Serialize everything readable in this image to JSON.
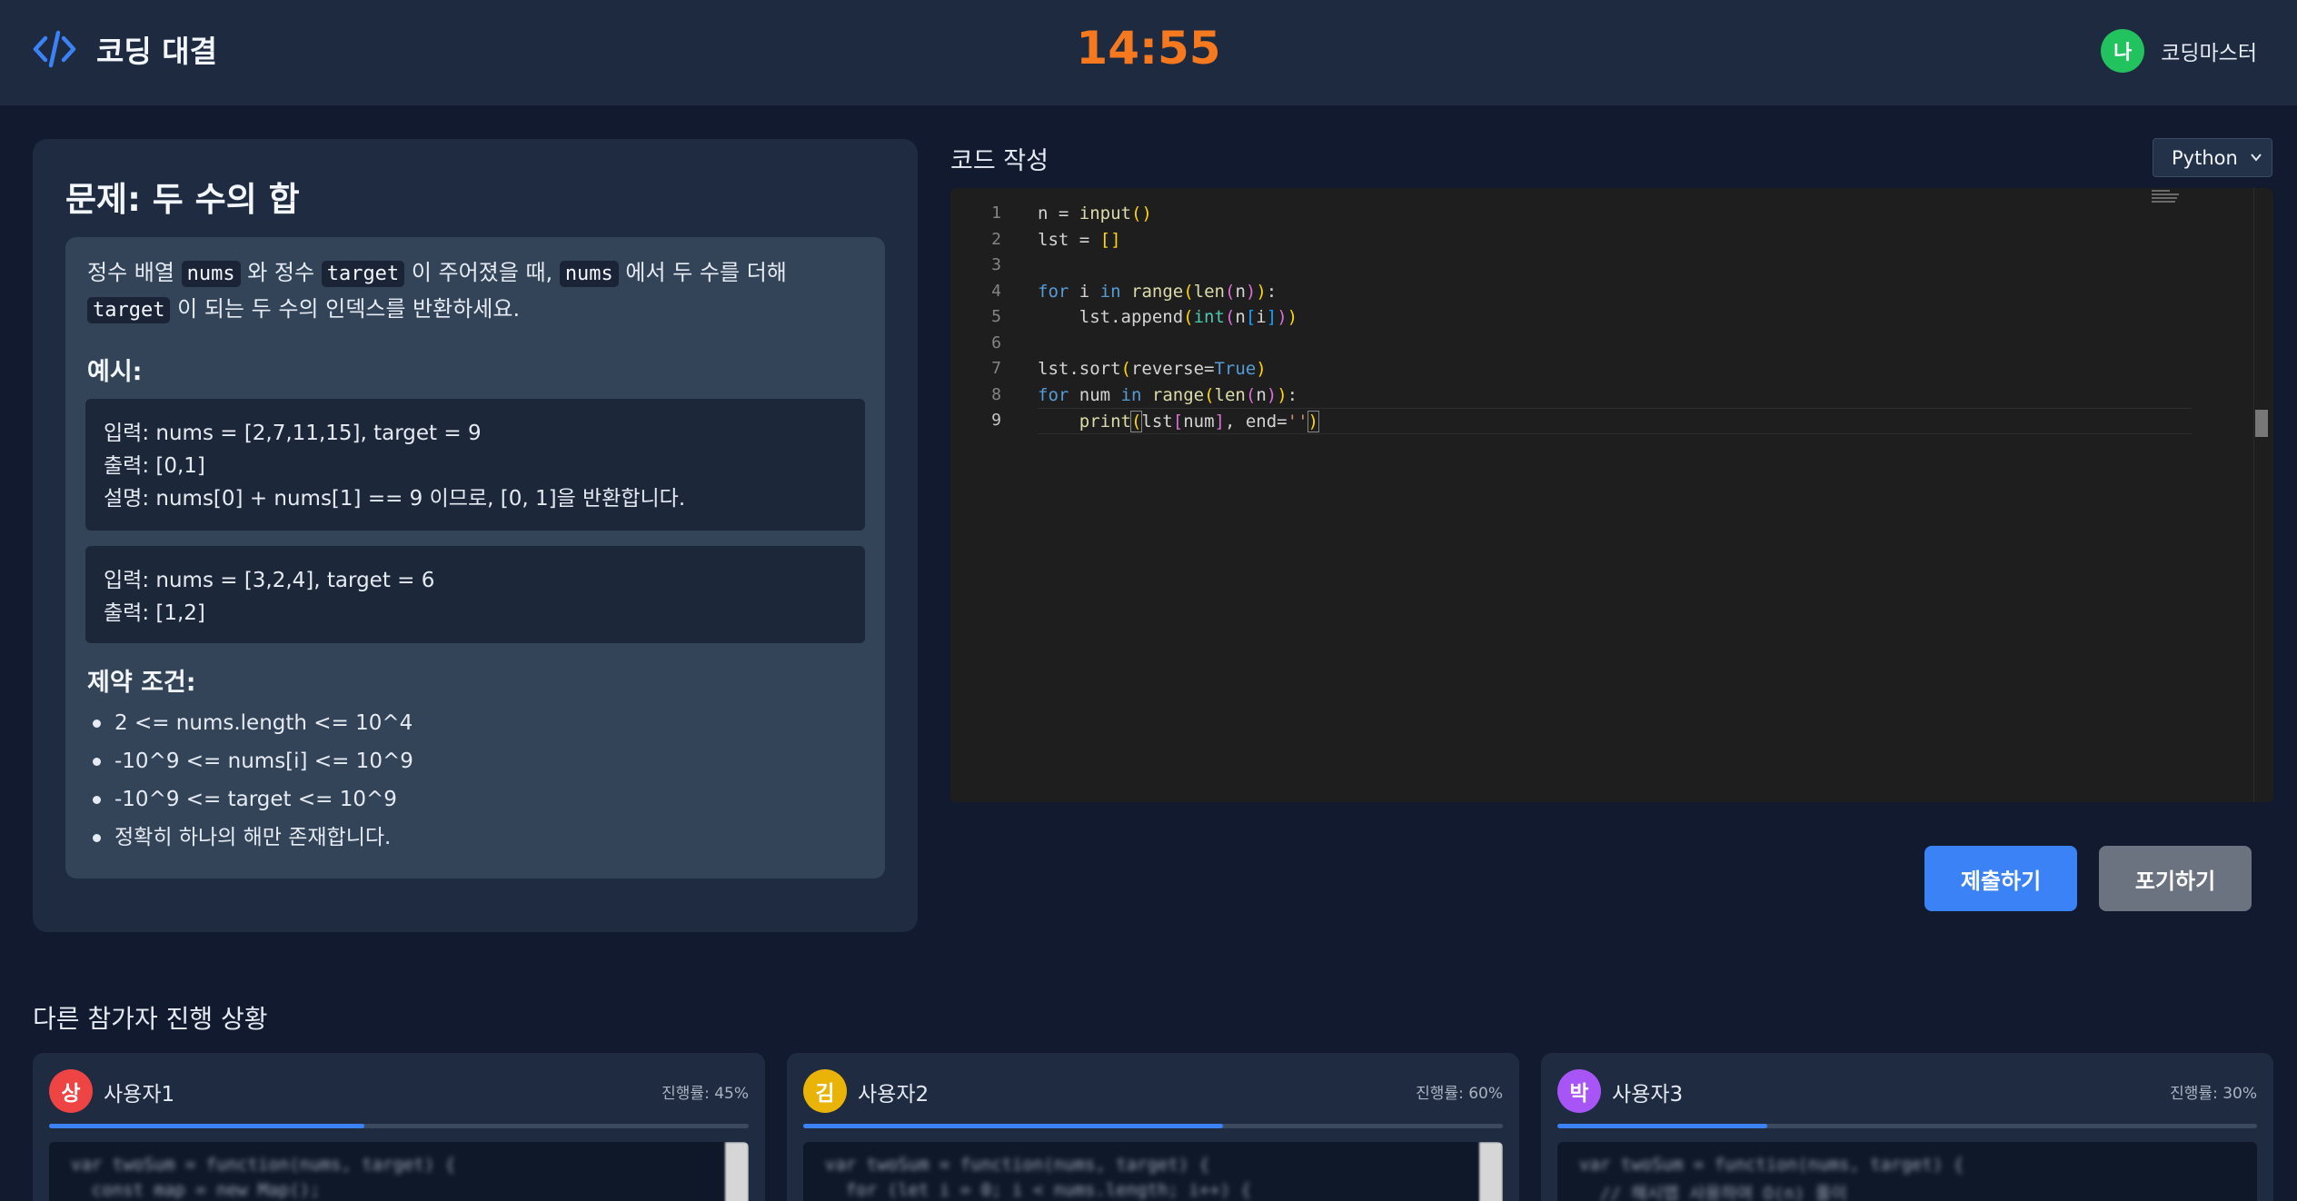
{
  "header": {
    "brand_title": "코딩 대결",
    "timer": "14:55",
    "user_initial": "나",
    "user_name": "코딩마스터"
  },
  "problem": {
    "title": "문제: 두 수의 합",
    "desc_1": "정수 배열 ",
    "desc_code_1": "nums",
    "desc_2": " 와 정수 ",
    "desc_code_2": "target",
    "desc_3": " 이 주어졌을 때, ",
    "desc_code_3": "nums",
    "desc_4": " 에서 두 수를 더해 ",
    "desc_code_4": "target",
    "desc_5": " 이 되는 두 수의 인덱스를 반환하세요.",
    "examples_heading": "예시:",
    "examples": [
      {
        "lines": [
          "입력: nums = [2,7,11,15], target = 9",
          "출력: [0,1]",
          "설명: nums[0] + nums[1] == 9 이므로, [0, 1]을 반환합니다."
        ]
      },
      {
        "lines": [
          "입력: nums = [3,2,4], target = 6",
          "출력: [1,2]"
        ]
      }
    ],
    "constraints_heading": "제약 조건:",
    "constraints": [
      "2 <= nums.length <= 10^4",
      "-10^9 <= nums[i] <= 10^9",
      "-10^9 <= target <= 10^9",
      "정확히 하나의 해만 존재합니다."
    ]
  },
  "editor": {
    "label": "코드 작성",
    "language": "Python",
    "line_numbers": [
      "1",
      "2",
      "3",
      "4",
      "5",
      "6",
      "7",
      "8",
      "9"
    ],
    "active_line": 9
  },
  "buttons": {
    "submit": "제출하기",
    "give_up": "포기하기"
  },
  "others": {
    "title": "다른 참가자 진행 상황",
    "participants": [
      {
        "initial": "상",
        "name": "사용자1",
        "progress_label": "진행률: 45%",
        "progress": 0.45,
        "color": "#ef4444",
        "code_1": "var twoSum = function(nums, target) {",
        "code_2": "  const map = new Map();"
      },
      {
        "initial": "김",
        "name": "사용자2",
        "progress_label": "진행률: 60%",
        "progress": 0.6,
        "color": "#eab308",
        "code_1": "var twoSum = function(nums, target) {",
        "code_2": "  for (let i = 0; i < nums.length; i++) {"
      },
      {
        "initial": "박",
        "name": "사용자3",
        "progress_label": "진행률: 30%",
        "progress": 0.3,
        "color": "#a855f7",
        "code_1": "var twoSum = function(nums, target) {",
        "code_2": "  // 해시맵 사용하여 O(n) 풀이"
      }
    ]
  },
  "colors": {
    "accent": "#3b82f6",
    "timer": "#f6791f",
    "online": "#22c25e"
  }
}
